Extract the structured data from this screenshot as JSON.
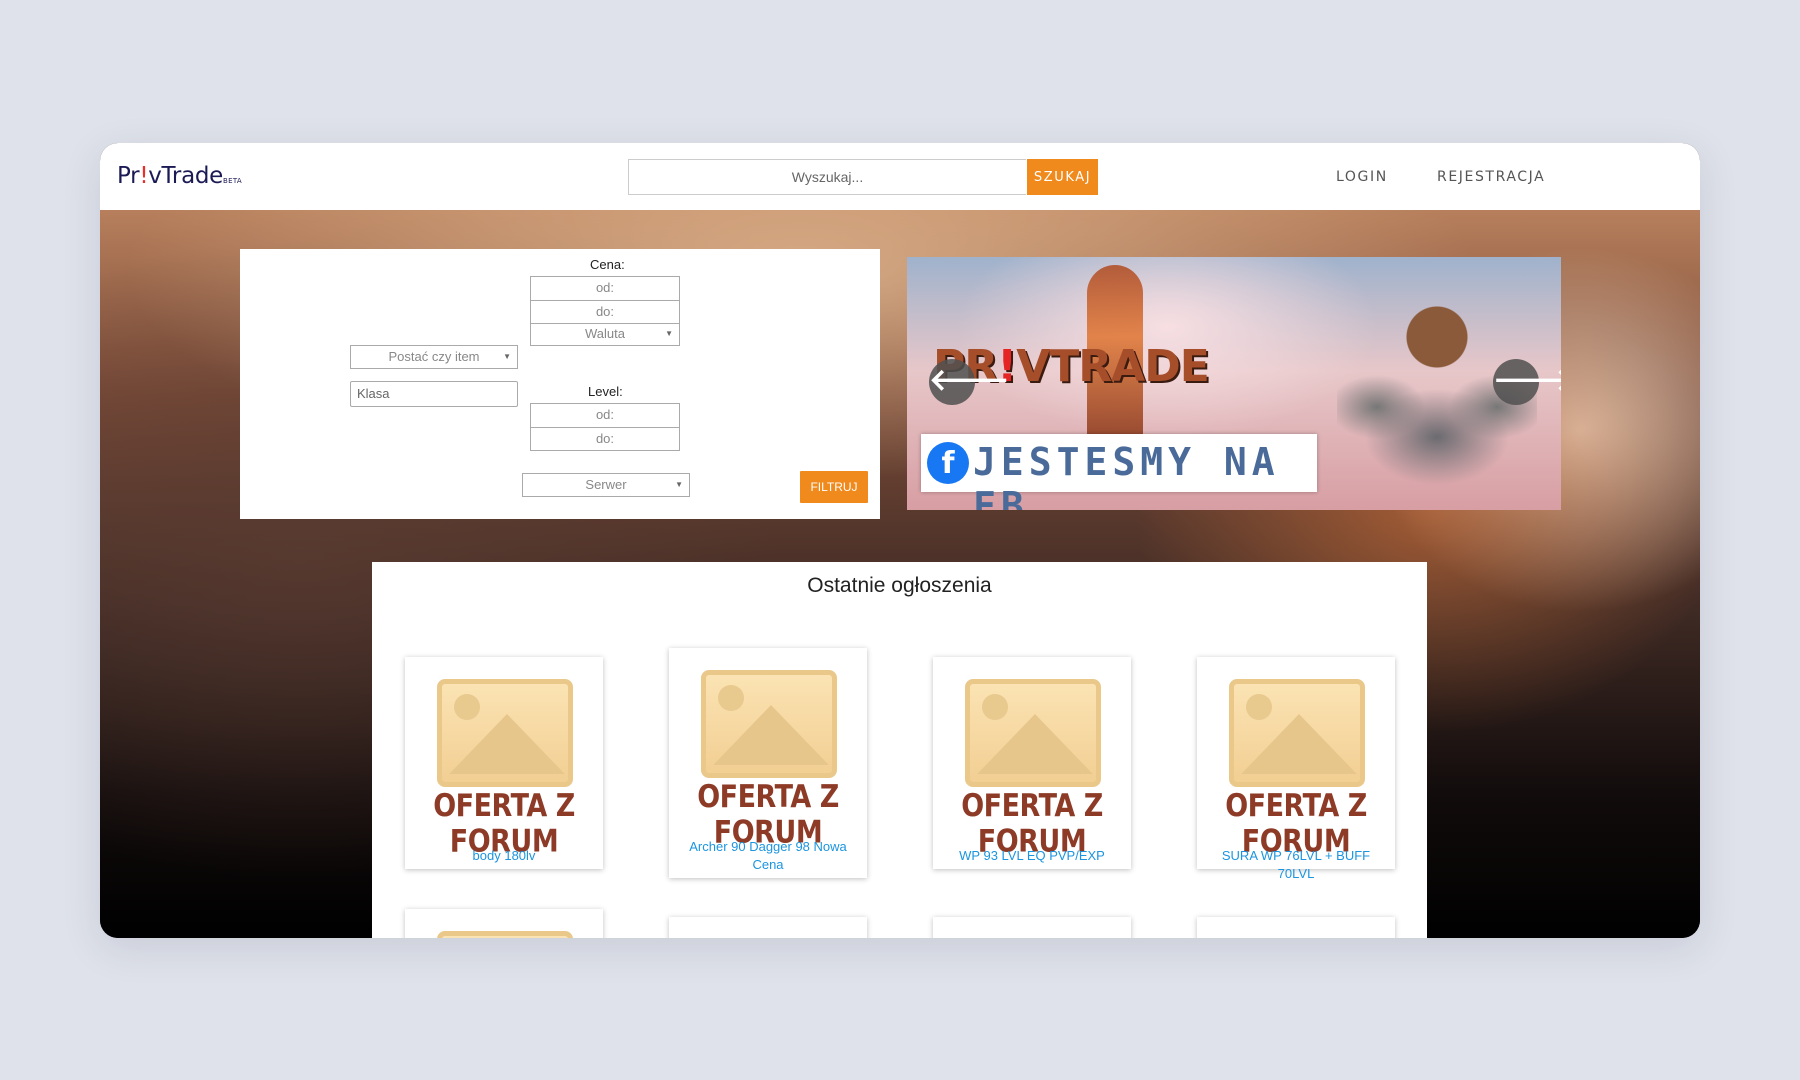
{
  "header": {
    "logo_prefix": "Pr",
    "logo_bang": "!",
    "logo_suffix": "vTrade",
    "logo_badge": "BETA",
    "search_placeholder": "Wyszukaj...",
    "search_button": "SZUKAJ",
    "nav": {
      "login": "LOGIN",
      "register": "REJESTRACJA"
    }
  },
  "filter": {
    "price_label": "Cena:",
    "price_from": "od:",
    "price_to": "do:",
    "currency": "Waluta",
    "type_select": "Postać czy item",
    "class_placeholder": "Klasa",
    "level_label": "Level:",
    "level_from": "od:",
    "level_to": "do:",
    "server_select": "Serwer",
    "filter_button": "FILTRUJ"
  },
  "banner": {
    "title_prefix": "PR",
    "title_bang": "!",
    "title_suffix": "VTRADE",
    "fb_letter": "f",
    "fb_text": "JESTESMY NA FB",
    "prev": "🡐",
    "next": "🡒"
  },
  "listings": {
    "title": "Ostatnie ogłoszenia",
    "cards": [
      {
        "badge": "OFERTA Z FORUM",
        "title": "body 180lv"
      },
      {
        "badge": "OFERTA Z FORUM",
        "title": "Archer 90 Dagger 98 Nowa Cena"
      },
      {
        "badge": "OFERTA Z FORUM",
        "title": "WP 93 LVL EQ PVP/EXP"
      },
      {
        "badge": "OFERTA Z FORUM",
        "title": "SURA WP 76LVL + BUFF 70LVL"
      }
    ]
  },
  "colors": {
    "accent": "#f08a1c",
    "link": "#1b95e0",
    "logo": "#1b1a55",
    "oferta": "#8d3b26"
  }
}
